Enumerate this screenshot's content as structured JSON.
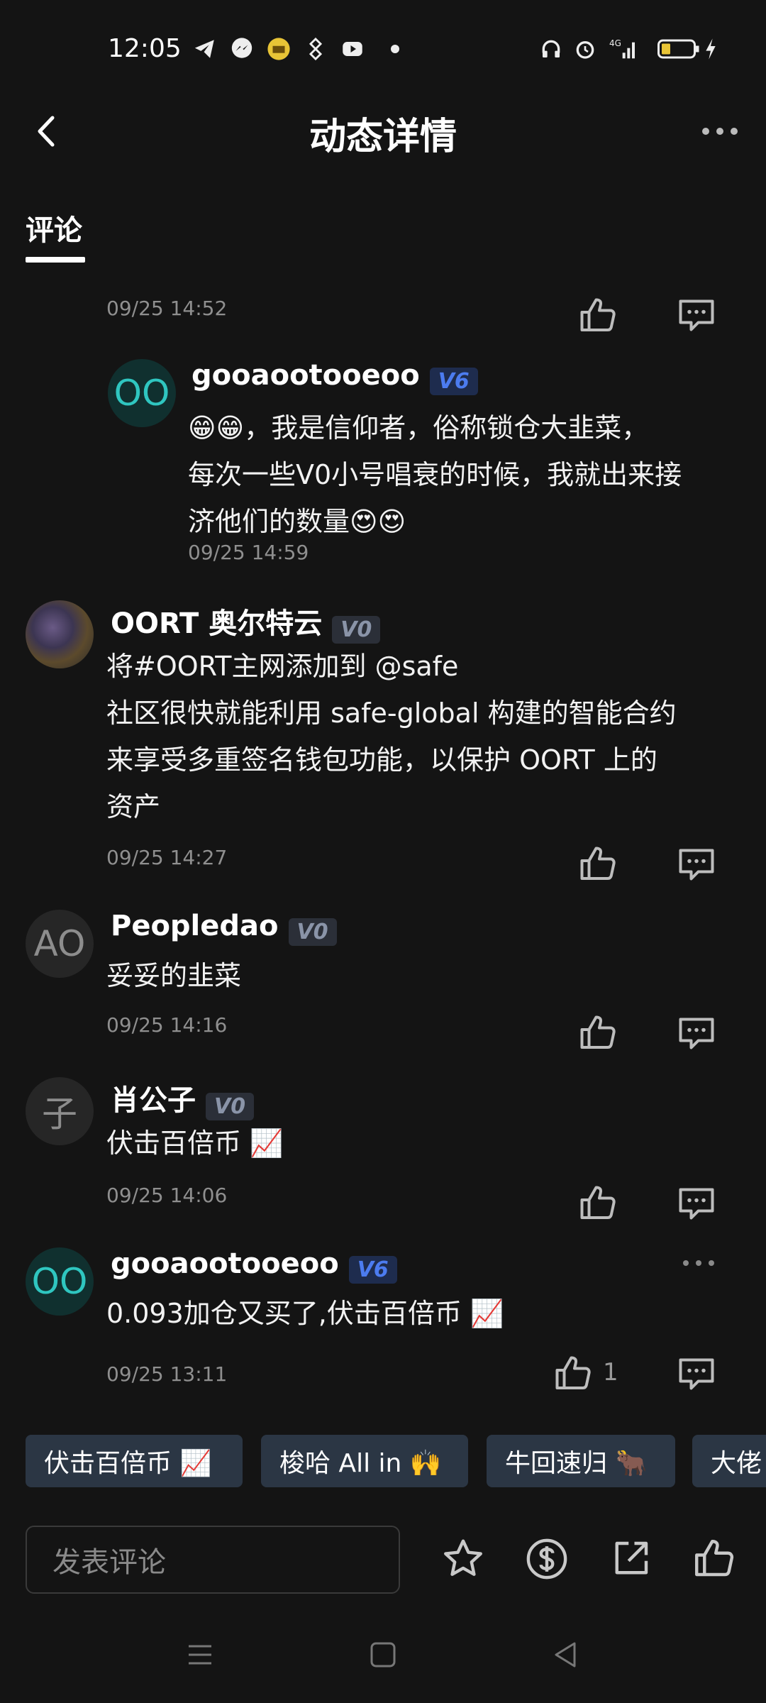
{
  "status_bar": {
    "time": "12:05",
    "left_icons": [
      "telegram-icon",
      "messenger-icon",
      "app-icon",
      "binance-icon",
      "youtube-icon",
      "dot-icon"
    ],
    "right_icons": [
      "headphones-icon",
      "alarm-icon",
      "signal-icon",
      "battery-icon",
      "charging-icon"
    ],
    "network": "4G"
  },
  "header": {
    "title": "动态详情"
  },
  "tabs": [
    {
      "label": "评论",
      "active": true
    }
  ],
  "comments": [
    {
      "timestamp": "09/25 14:52"
    },
    {
      "avatar": "OO",
      "username": "gooaootooeoo",
      "level": "V6",
      "text": "😁😁，我是信仰者，俗称锁仓大韭菜，\n每次一些V0小号唱衰的时候，我就出来接\n济他们的数量😍😍",
      "timestamp": "09/25 14:59"
    },
    {
      "username": "OORT 奥尔特云",
      "level": "V0",
      "text": "将#OORT主网添加到 @safe\n社区很快就能利用 safe-global 构建的智能合约\n来享受多重签名钱包功能，以保护 OORT 上的\n资产",
      "timestamp": "09/25 14:27"
    },
    {
      "avatar": "AO",
      "username": "Peopledao",
      "level": "V0",
      "text": "妥妥的韭菜",
      "timestamp": "09/25 14:16"
    },
    {
      "avatar": "子",
      "username": "肖公子",
      "level": "V0",
      "text": "伏击百倍币 📈",
      "timestamp": "09/25 14:06"
    },
    {
      "avatar": "OO",
      "username": "gooaootooeoo",
      "level": "V6",
      "text": "0.093加仓又买了,伏击百倍币 📈",
      "timestamp": "09/25 13:11",
      "like_count": "1"
    }
  ],
  "quick_replies": [
    "伏击百倍币 📈",
    "梭哈 All in 🙌",
    "牛回速归 🐂",
    "大佬"
  ],
  "bottom_bar": {
    "input_placeholder": "发表评论"
  },
  "colors": {
    "background": "#141414",
    "v6_badge": "#4c7cf0",
    "v0_badge": "#8a94a8",
    "avatar_oo": "#2fc6c0",
    "chip_bg": "#2b3644"
  }
}
